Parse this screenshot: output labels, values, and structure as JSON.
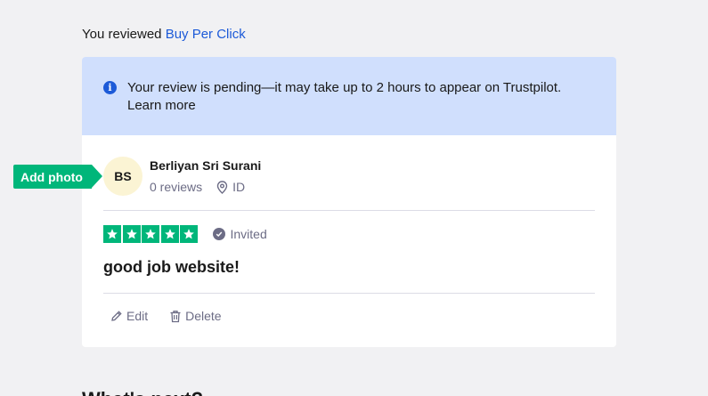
{
  "reviewed": {
    "prefix": "You reviewed",
    "company": "Buy Per Click"
  },
  "notice": {
    "icon": "info-icon",
    "text": "Your review is pending—it may take up to 2 hours to appear on Trustpilot.",
    "link": "Learn more"
  },
  "reviewer": {
    "initials": "BS",
    "name": "Berliyan Sri Surani",
    "reviews": "0 reviews",
    "location": "ID"
  },
  "add_photo": "Add photo",
  "review": {
    "stars": 5,
    "status": "Invited",
    "title": "good job website!"
  },
  "actions": {
    "edit": "Edit",
    "delete": "Delete"
  },
  "below_heading": "What's next?",
  "colors": {
    "accent_green": "#00b67a",
    "link_blue": "#1c5ad8",
    "notice_bg": "#d0dffd"
  }
}
